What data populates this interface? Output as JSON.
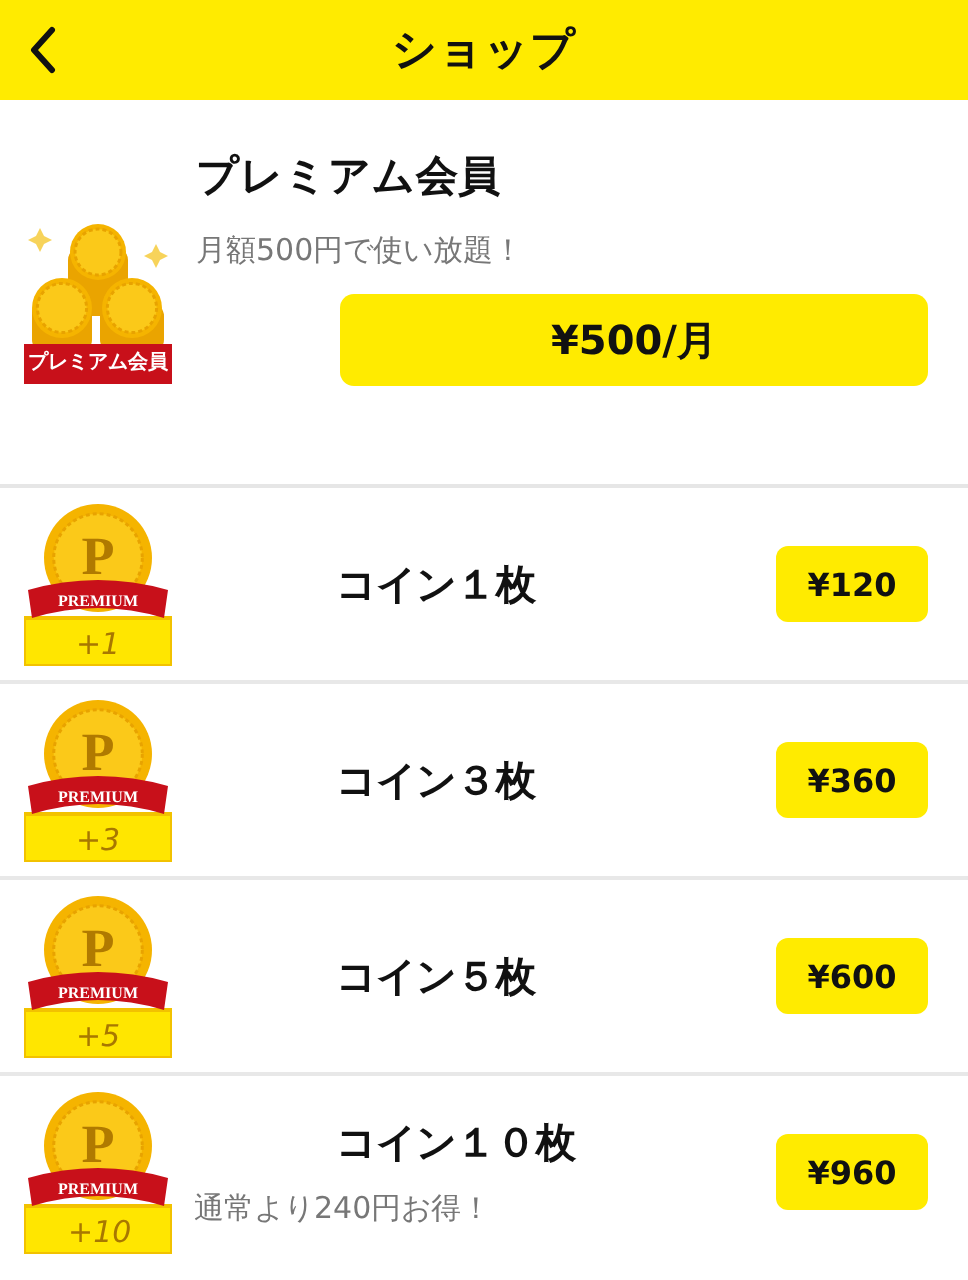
{
  "header": {
    "title": "ショップ"
  },
  "premium": {
    "badge": "プレミアム会員",
    "title": "プレミアム会員",
    "subtitle": "月額500円で使い放題！",
    "price": "¥500/月"
  },
  "coins": [
    {
      "symbol": "P",
      "badge": "PREMIUM",
      "amount": "+1",
      "name": "コイン１枚",
      "price": "¥120"
    },
    {
      "symbol": "P",
      "badge": "PREMIUM",
      "amount": "+3",
      "name": "コイン３枚",
      "price": "¥360"
    },
    {
      "symbol": "P",
      "badge": "PREMIUM",
      "amount": "+5",
      "name": "コイン５枚",
      "price": "¥600"
    },
    {
      "symbol": "P",
      "badge": "PREMIUM",
      "amount": "+10",
      "name": "コイン１０枚",
      "note": "通常より240円お得！",
      "price": "¥960"
    }
  ]
}
